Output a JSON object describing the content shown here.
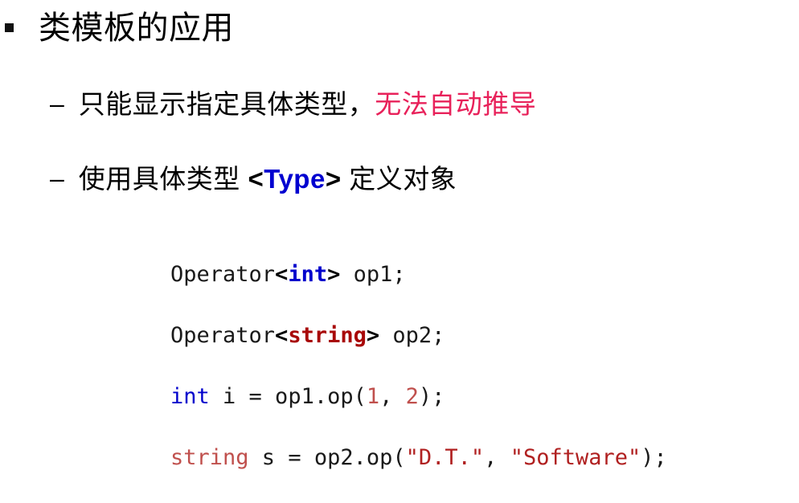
{
  "slide": {
    "background_color": "#FFFFFF",
    "markers": {
      "level1": "square-bullet",
      "level2": "–"
    },
    "title": "类模板的应用",
    "points": [
      {
        "marker": "–",
        "text_plain": "使用具体类型 <Type> 定义对象",
        "lead": "只能显示指定具体类型，",
        "highlight": "无法自动推导",
        "highlight_color": "#E8215A"
      },
      {
        "marker": "–",
        "lead": "使用具体类型 ",
        "tag_open": "<",
        "tag_name": "Type",
        "tag_close": ">",
        "tag_color": "#0000D0",
        "tail": " 定义对象"
      }
    ]
  },
  "code": {
    "language": "cpp",
    "lines": [
      {
        "plain": "Operator<int> op1;",
        "tokens": [
          {
            "t": "Operator",
            "c": "#1A1A1A"
          },
          {
            "t": "<",
            "c": "#000000"
          },
          {
            "t": "int",
            "c": "#0000CC"
          },
          {
            "t": ">",
            "c": "#000000"
          },
          {
            "t": " op1;",
            "c": "#1A1A1A"
          }
        ]
      },
      {
        "plain": "Operator<string> op2;",
        "tokens": [
          {
            "t": "Operator",
            "c": "#1A1A1A"
          },
          {
            "t": "<",
            "c": "#000000"
          },
          {
            "t": "string",
            "c": "#A80808"
          },
          {
            "t": ">",
            "c": "#000000"
          },
          {
            "t": " op2;",
            "c": "#1A1A1A"
          }
        ]
      },
      {
        "plain": "int i = op1.op(1, 2);",
        "tokens": [
          {
            "t": "int",
            "c": "#0000CC"
          },
          {
            "t": " i = op1.op(",
            "c": "#1A1A1A"
          },
          {
            "t": "1",
            "c": "#C0504D"
          },
          {
            "t": ", ",
            "c": "#1A1A1A"
          },
          {
            "t": "2",
            "c": "#C0504D"
          },
          {
            "t": ");",
            "c": "#1A1A1A"
          }
        ]
      },
      {
        "plain": "string s = op2.op(\"D.T.\", \"Software\");",
        "tokens": [
          {
            "t": "string",
            "c": "#C0504D"
          },
          {
            "t": " s = op2.op(",
            "c": "#1A1A1A"
          },
          {
            "t": "\"D.T.\"",
            "c": "#B02020"
          },
          {
            "t": ", ",
            "c": "#1A1A1A"
          },
          {
            "t": "\"Software\"",
            "c": "#B02020"
          },
          {
            "t": ");",
            "c": "#1A1A1A"
          }
        ]
      }
    ],
    "segments": {
      "l1_a": "Operator",
      "l1_open": "<",
      "l1_kw": "int",
      "l1_close": ">",
      "l1_b": " op1;",
      "l2_a": "Operator",
      "l2_open": "<",
      "l2_kw": "string",
      "l2_close": ">",
      "l2_b": " op2;",
      "l3_kw": "int",
      "l3_a": " i = op1.op(",
      "l3_n1": "1",
      "l3_sep": ", ",
      "l3_n2": "2",
      "l3_b": ");",
      "l4_kw": "string",
      "l4_a": " s = op2.op(",
      "l4_s1": "\"D.T.\"",
      "l4_sep": ", ",
      "l4_s2": "\"Software\"",
      "l4_b": ");"
    }
  }
}
